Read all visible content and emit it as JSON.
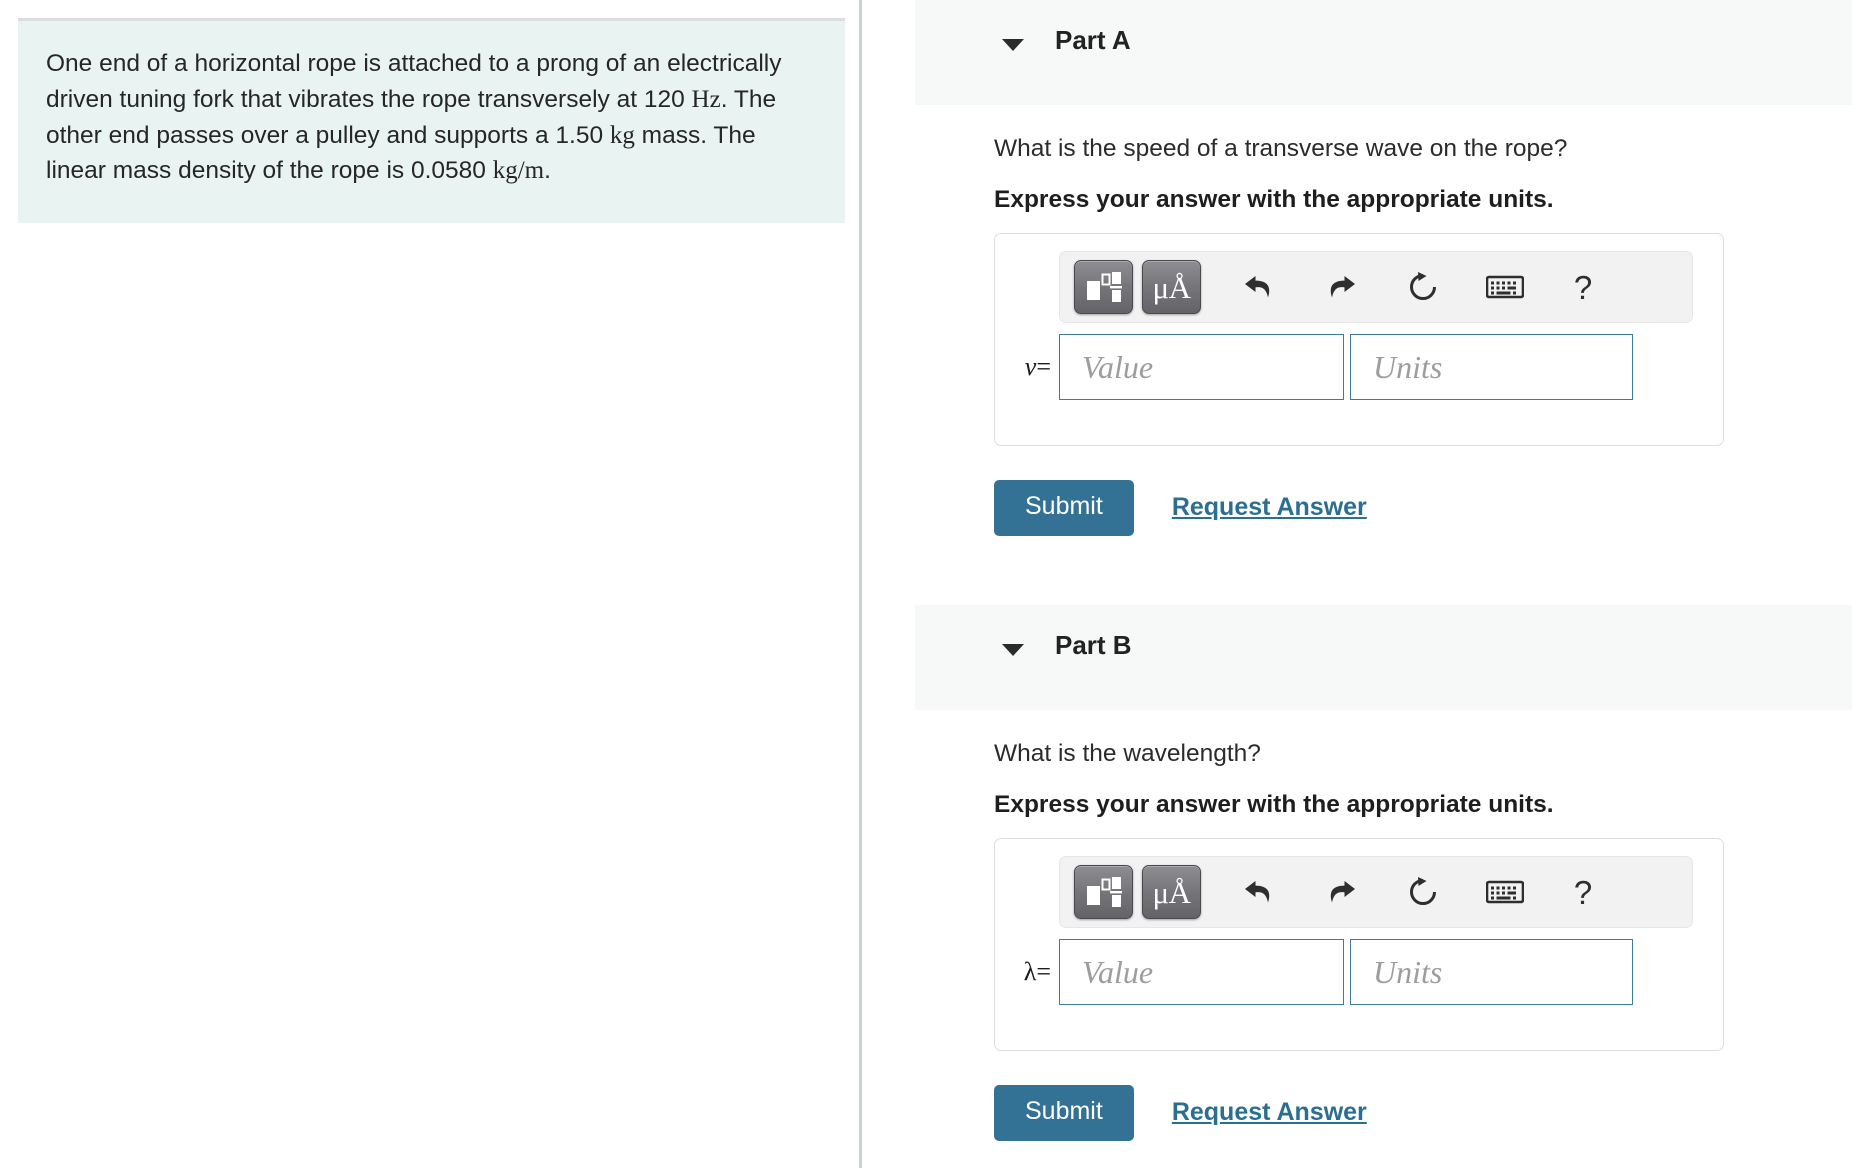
{
  "problem": {
    "segments": [
      {
        "t": "One end of a horizontal rope is attached to a prong of an electrically driven tuning fork that vibrates the rope transversely at ",
        "math": false
      },
      {
        "t": "120 ",
        "math": false
      },
      {
        "t": "Hz",
        "math": true
      },
      {
        "t": ". The other end passes over a pulley and supports a 1.50 ",
        "math": false
      },
      {
        "t": "kg",
        "math": true
      },
      {
        "t": " mass. The linear mass density of the rope is 0.0580 ",
        "math": false
      },
      {
        "t": "kg/m",
        "math": true
      },
      {
        "t": ".",
        "math": false
      }
    ],
    "full_text": "One end of a horizontal rope is attached to a prong of an electrically driven tuning fork that vibrates the rope transversely at 120 Hz. The other end passes over a pulley and supports a 1.50 kg mass. The linear mass density of the rope is 0.0580 kg/m.",
    "values": {
      "frequency": "120 Hz",
      "mass": "1.50 kg",
      "linear_mass_density": "0.0580 kg/m"
    },
    "background_color": "#e9f4f2"
  },
  "toolbar": {
    "math_template_title": "math-template",
    "units_label": "μÅ",
    "undo_title": "undo",
    "redo_title": "redo",
    "reset_title": "reset",
    "keyboard_title": "keyboard",
    "help_label": "?"
  },
  "fields": {
    "value_placeholder": "Value",
    "units_placeholder": "Units",
    "value_current": "",
    "units_current": ""
  },
  "actions": {
    "submit_label": "Submit",
    "request_answer_label": "Request Answer",
    "submit_color": "#337295",
    "link_color": "#2a6f91"
  },
  "parts": [
    {
      "id": "part-a",
      "title": "Part A",
      "question": "What is the speed of a transverse wave on the rope?",
      "instruction": "Express your answer with the appropriate units.",
      "variable": "v",
      "equals": "="
    },
    {
      "id": "part-b",
      "title": "Part B",
      "question": "What is the wavelength?",
      "instruction": "Express your answer with the appropriate units.",
      "variable": "λ",
      "equals": "="
    }
  ]
}
